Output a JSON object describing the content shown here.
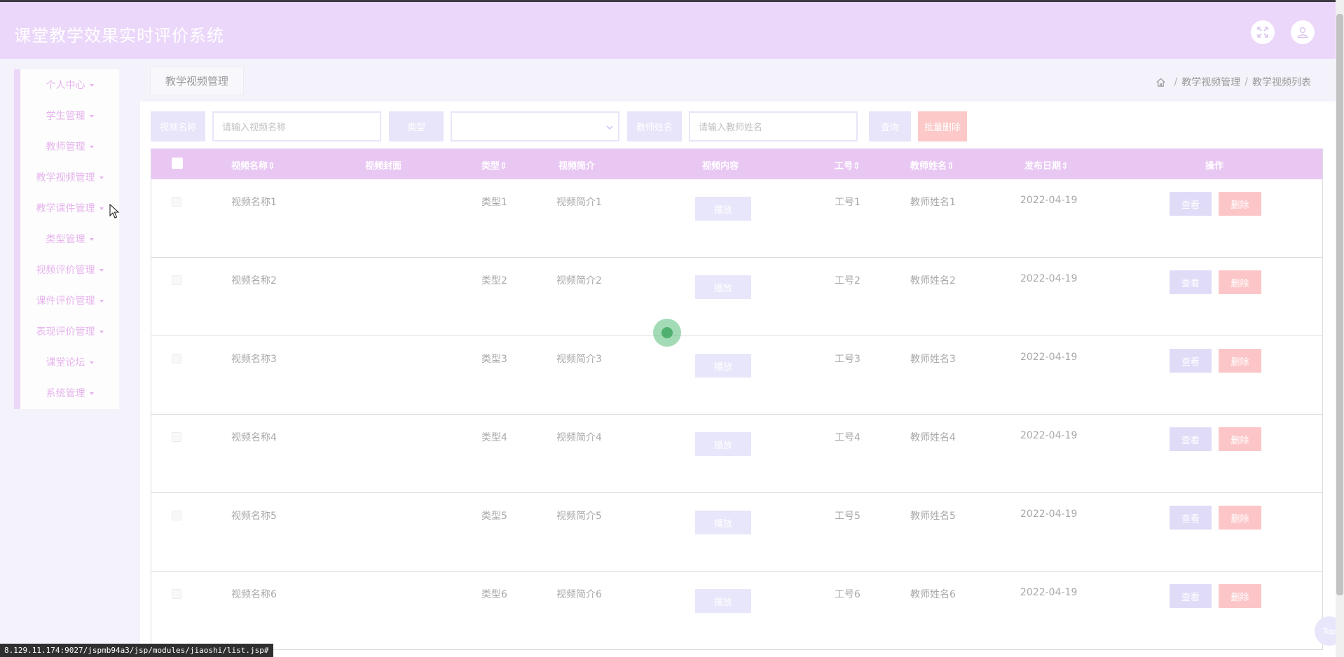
{
  "header": {
    "title": "课堂教学效果实时评价系统",
    "fullscreen_icon": "fullscreen-icon",
    "user_icon": "user-icon"
  },
  "sidebar": {
    "items": [
      {
        "label": "个人中心"
      },
      {
        "label": "学生管理"
      },
      {
        "label": "教师管理"
      },
      {
        "label": "教学视频管理"
      },
      {
        "label": "教学课件管理"
      },
      {
        "label": "类型管理"
      },
      {
        "label": "视频评价管理"
      },
      {
        "label": "课件评价管理"
      },
      {
        "label": "表现评价管理"
      },
      {
        "label": "课堂论坛"
      },
      {
        "label": "系统管理"
      }
    ]
  },
  "page": {
    "tab_label": "教学视频管理",
    "breadcrumb": [
      "教学视频管理",
      "教学视频列表"
    ],
    "breadcrumb_sep": "/"
  },
  "filters": {
    "video_name_label": "视频名称",
    "video_name_placeholder": "请输入视频名称",
    "type_label": "类型",
    "teacher_name_label": "教师姓名",
    "teacher_name_placeholder": "请输入教师姓名",
    "search_label": "查询",
    "batch_delete_label": "批量删除"
  },
  "table": {
    "headers": {
      "name": "视频名称",
      "cover": "视频封面",
      "type": "类型",
      "intro": "视频简介",
      "content": "视频内容",
      "job_no": "工号",
      "teacher": "教师姓名",
      "date": "发布日期",
      "ops": "操作"
    },
    "sort_mark": "⇕",
    "play_label": "播放",
    "view_label": "查看",
    "delete_label": "删除",
    "rows": [
      {
        "name": "视频名称1",
        "type": "类型1",
        "intro": "视频简介1",
        "job_no": "工号1",
        "teacher": "教师姓名1",
        "date": "2022-04-19"
      },
      {
        "name": "视频名称2",
        "type": "类型2",
        "intro": "视频简介2",
        "job_no": "工号2",
        "teacher": "教师姓名2",
        "date": "2022-04-19"
      },
      {
        "name": "视频名称3",
        "type": "类型3",
        "intro": "视频简介3",
        "job_no": "工号3",
        "teacher": "教师姓名3",
        "date": "2022-04-19"
      },
      {
        "name": "视频名称4",
        "type": "类型4",
        "intro": "视频简介4",
        "job_no": "工号4",
        "teacher": "教师姓名4",
        "date": "2022-04-19"
      },
      {
        "name": "视频名称5",
        "type": "类型5",
        "intro": "视频简介5",
        "job_no": "工号5",
        "teacher": "教师姓名5",
        "date": "2022-04-19"
      },
      {
        "name": "视频名称6",
        "type": "类型6",
        "intro": "视频简介6",
        "job_no": "工号6",
        "teacher": "教师姓名6",
        "date": "2022-04-19"
      }
    ]
  },
  "status_url": "8.129.11.174:9027/jspmb94a3/jsp/modules/jiaoshi/list.jsp#",
  "back_to_top_label": "Top",
  "colors": {
    "header_bg": "#ebd7fa",
    "table_header_bg": "#e9c7f3",
    "sidebar_text": "#e6b4ec",
    "button_bg": "#e8e5fa",
    "delete_bg": "#fcc8c8"
  }
}
